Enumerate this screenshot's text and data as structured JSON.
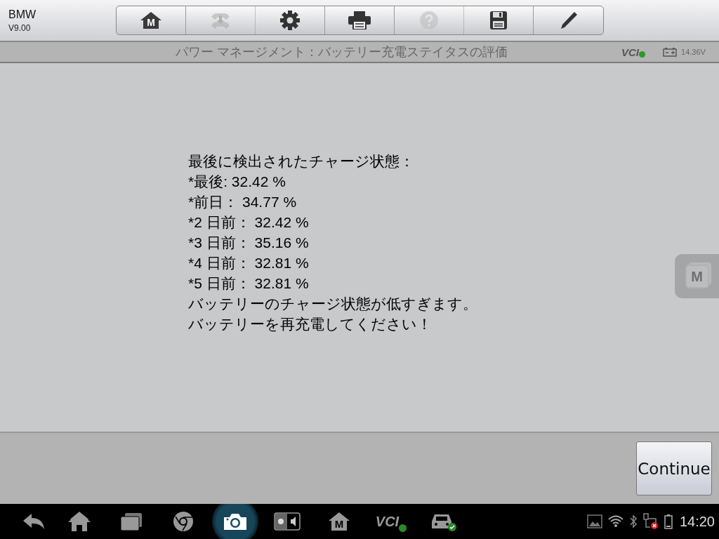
{
  "app": {
    "name": "BMW",
    "version": "V9.00"
  },
  "toolbar": [
    {
      "kind": "home",
      "glyph": "M",
      "disabled": false
    },
    {
      "kind": "transfer",
      "disabled": true
    },
    {
      "kind": "settings",
      "disabled": false
    },
    {
      "kind": "print",
      "disabled": false
    },
    {
      "kind": "help",
      "disabled": true
    },
    {
      "kind": "save",
      "disabled": false
    },
    {
      "kind": "edit",
      "disabled": false
    }
  ],
  "title": "パワー マネージメント：バッテリー充電ステイタスの評価",
  "vci": {
    "label": "VCI",
    "connected": true
  },
  "battery_voltage": "14.36V",
  "message": [
    "最後に検出されたチャージ状態：",
    "*最後: 32.42 %",
    "*前日： 34.77 %",
    "*2 日前： 32.42 %",
    "*3 日前： 35.16 %",
    "*4 日前： 32.81 %",
    "*5 日前： 32.81 %",
    "バッテリーのチャージ状態が低すぎます。",
    "バッテリーを再充電してください！"
  ],
  "float_button": {
    "glyph": "M"
  },
  "continue_button": "Continue",
  "taskbar": [
    {
      "kind": "back",
      "selected": false
    },
    {
      "kind": "home",
      "selected": false
    },
    {
      "kind": "recent",
      "selected": false
    },
    {
      "kind": "browser",
      "selected": false
    },
    {
      "kind": "camera",
      "selected": true
    },
    {
      "kind": "display",
      "selected": false
    },
    {
      "kind": "app",
      "glyph": "M",
      "selected": false
    },
    {
      "kind": "vci",
      "glyph": "VCI",
      "selected": false
    },
    {
      "kind": "car",
      "selected": false
    }
  ],
  "status": {
    "time": "14:20"
  }
}
